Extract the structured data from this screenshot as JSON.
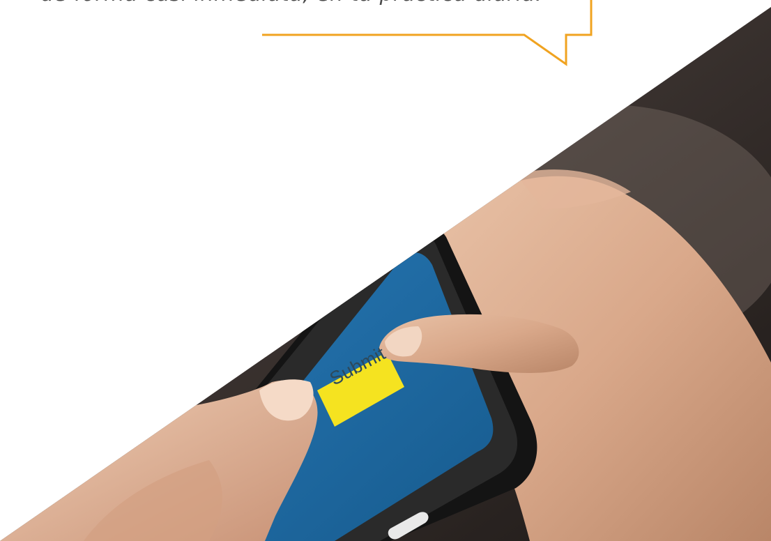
{
  "quote": {
    "text": "de forma casi inmediata, en tu práctica diaria."
  },
  "phone": {
    "button_label": "Submit"
  },
  "colors": {
    "accent": "#f0a320",
    "screen": "#1f6aa3",
    "submit_button": "#f5e320",
    "phone_body": "#161616",
    "background": "#ffffff"
  }
}
